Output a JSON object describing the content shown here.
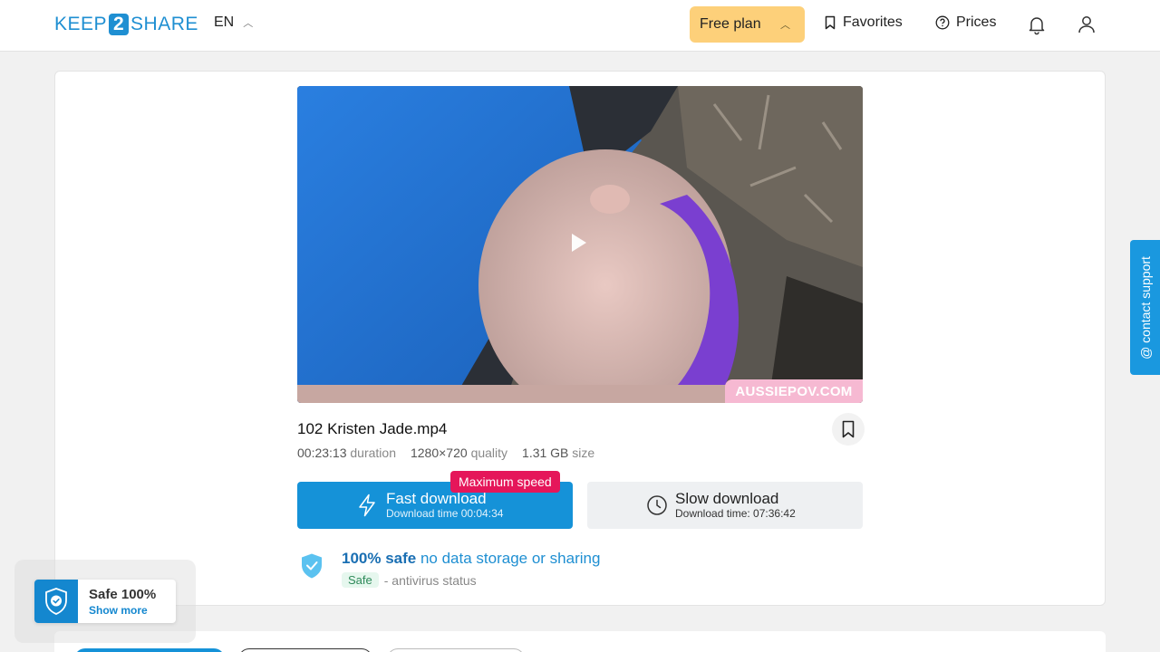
{
  "header": {
    "logo_left": "KEEP",
    "logo_mid": "2",
    "logo_right": "SHARE",
    "language": "EN",
    "plan_label": "Free plan",
    "favorites_label": "Favorites",
    "prices_label": "Prices"
  },
  "video": {
    "watermark": "AUSSIEPOV.COM"
  },
  "file": {
    "name": "102 Kristen Jade.mp4",
    "duration": "00:23:13",
    "duration_label": "duration",
    "quality": "1280×720",
    "quality_label": "quality",
    "size": "1.31 GB",
    "size_label": "size"
  },
  "download": {
    "fast_label": "Fast download",
    "fast_time": "Download time 00:04:34",
    "speed_badge": "Maximum speed",
    "slow_label": "Slow download",
    "slow_time": "Download time: 07:36:42"
  },
  "safety": {
    "strong": "100% safe",
    "rest": "no data storage or sharing",
    "status_pill": "Safe",
    "status_text": "- antivirus status"
  },
  "support_label": "@ contact support",
  "safe_popup": {
    "title": "Safe 100%",
    "link": "Show more"
  },
  "colors": {
    "brand": "#1f8fd2",
    "plan": "#fdd07a",
    "fast": "#1592d8",
    "badge": "#e5165a"
  }
}
